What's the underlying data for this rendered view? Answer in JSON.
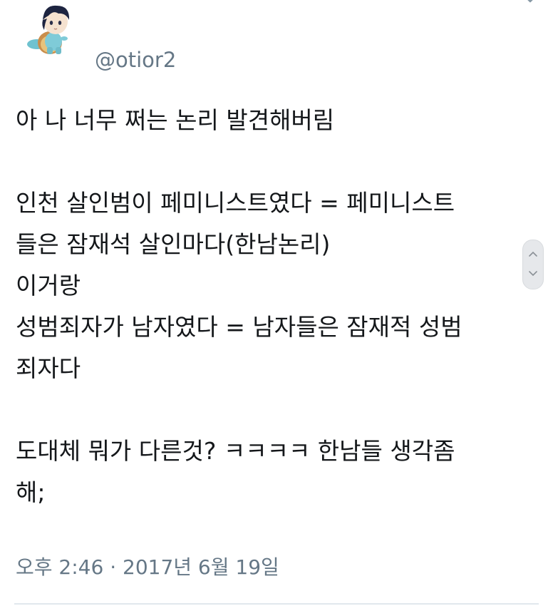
{
  "tweet": {
    "handle": "@otior2",
    "avatar_icon": "character-avatar-icon",
    "lines": [
      "아 나 너무 쩌는 논리 발견해버림",
      "인천 살인범이 페미니스트였다 = 페미니스트",
      "들은 잠재석 살인마다(한남논리)",
      "이거랑",
      "성범죄자가 남자였다 = 남자들은 잠재적 성범",
      "죄자다",
      "도대체 뭐가 다른것? ㅋㅋㅋㅋ 한남들 생각좀",
      "해;"
    ],
    "timestamp": "오후 2:46 · 2017년 6월 19일"
  },
  "colors": {
    "text": "#14171a",
    "muted": "#657786",
    "divider": "#e1e8ed"
  }
}
